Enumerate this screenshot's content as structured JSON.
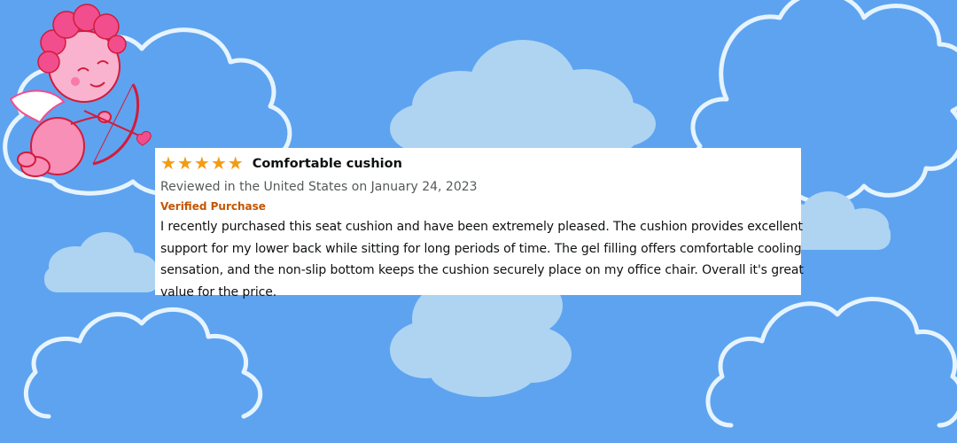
{
  "review": {
    "rating": 5,
    "rating_max": 5,
    "title": "Comfortable cushion",
    "meta": "Reviewed in the United States on January 24, 2023",
    "badge": "Verified Purchase",
    "body": "I recently purchased this seat cushion and have been extremely pleased. The cushion provides excellent support for my lower back while sitting for long periods of time. The gel filling offers comfortable cooling sensation, and the non-slip bottom keeps the cushion securely place on my office chair. Overall it's great value for the price."
  },
  "colors": {
    "background": "#5ea3f0",
    "cloud_fill": "#aed4f2",
    "cloud_outline": "#e6f4ff",
    "star": "#f39c12",
    "badge": "#c45500",
    "cupid_body": "#f78fb7",
    "cupid_hair": "#f24d8d",
    "bow": "#d31b3a"
  },
  "decorations": {
    "clouds": [
      "cloud-filled",
      "cloud-outline"
    ],
    "character": "cupid-illustration"
  }
}
